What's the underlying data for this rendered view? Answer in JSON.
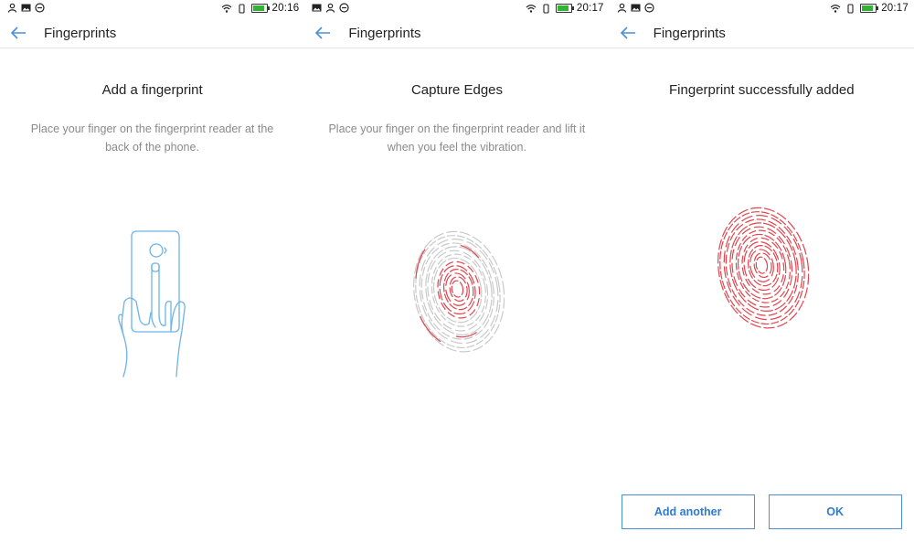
{
  "colors": {
    "accent": "#4a90d9",
    "fingerprint_red": "#e0454f",
    "fingerprint_gray": "#c9c9c9",
    "battery": "#34b233"
  },
  "screens": [
    {
      "time": "20:16",
      "header_title": "Fingerprints",
      "headline": "Add a fingerprint",
      "description": "Place your finger on the fingerprint reader at the back of the phone.",
      "icons": [
        "back-arrow-icon",
        "hand-phone-illustration"
      ]
    },
    {
      "time": "20:17",
      "header_title": "Fingerprints",
      "headline": "Capture Edges",
      "description": "Place your finger on the fingerprint reader and lift it when you feel the vibration.",
      "icons": [
        "back-arrow-icon",
        "fingerprint-partial-icon"
      ]
    },
    {
      "time": "20:17",
      "header_title": "Fingerprints",
      "headline": "Fingerprint successfully added",
      "description": "",
      "icons": [
        "back-arrow-icon",
        "fingerprint-complete-icon"
      ],
      "buttons": {
        "add_another": "Add another",
        "ok": "OK"
      }
    }
  ]
}
